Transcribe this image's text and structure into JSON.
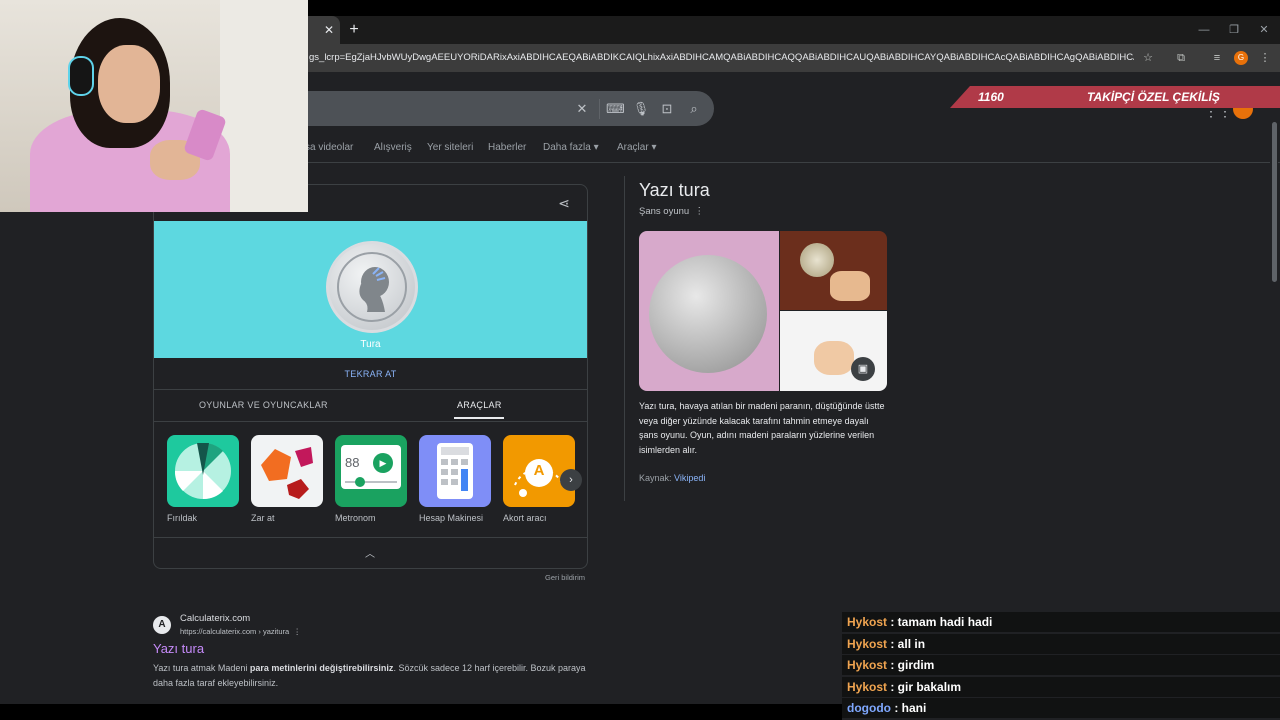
{
  "browser": {
    "url": "gs_lcrp=EgZjaHJvbWUyDwgAEEUYORiDARixAxiABDIHCAEQABiABDIKCAIQLhixAxiABDIHCAMQABiABDIHCAQQABiABDIHCAUQABiABDIHCAYQABiABDIHCAcQABiABDIHCAgQABiABDIHCAkQABiABNIB...",
    "profile_initial": "G"
  },
  "nav": {
    "items": [
      "sa videolar",
      "Alışveriş",
      "Yer siteleri",
      "Haberler",
      "Daha fazla",
      "Araçlar"
    ]
  },
  "coin_card": {
    "result_label": "Tura",
    "retry_label": "TEKRAR AT",
    "tabs": [
      "OYUNLAR VE OYUNCAKLAR",
      "ARAÇLAR"
    ],
    "active_tab": "ARAÇLAR",
    "tools": [
      {
        "name": "Fırıldak",
        "color": "#1ec99e"
      },
      {
        "name": "Zar at",
        "color": "#f1f3f4"
      },
      {
        "name": "Metronom",
        "color": "#1aa260",
        "display": "88"
      },
      {
        "name": "Hesap Makinesi",
        "color": "#7f8ef7"
      },
      {
        "name": "Akort aracı",
        "color": "#f29900",
        "display": "A"
      }
    ],
    "feedback": "Geri bildirim"
  },
  "result": {
    "logo_letter": "A",
    "site": "Calculaterix.com",
    "url": "https://calculaterix.com › yazitura",
    "title": "Yazı tura",
    "snippet_a": "Yazı tura atmak Madeni ",
    "snippet_bold": "para metinlerini değiştirebilirsiniz",
    "snippet_b": ". Sözcük sadece 12 harf içerebilir. Bozuk paraya daha fazla taraf ekleyebilirsiniz."
  },
  "knowledge_panel": {
    "title": "Yazı tura",
    "subtitle": "Şans oyunu",
    "description": "Yazı tura, havaya atılan bir madeni paranın, düştüğünde üstte veya diğer yüzünde kalacak tarafını tahmin etmeye dayalı şans oyunu. Oyun, adını madeni paraların yüzlerine verilen isimlerden alır.",
    "source_label": "Kaynak: ",
    "source_link": "Vikipedi"
  },
  "stream": {
    "banner_number": "1160",
    "banner_text": "TAKİPÇİ ÖZEL ÇEKİLİŞ",
    "chat": [
      {
        "user": "Hykost",
        "msg": " : tamam hadi hadi"
      },
      {
        "user": "Hykost",
        "msg": " : all in"
      },
      {
        "user": "Hykost",
        "msg": " : girdim"
      },
      {
        "user": "Hykost",
        "msg": " : gir bakalım"
      },
      {
        "user": "dogodo",
        "msg": " : hani",
        "color": "#7fa8ff"
      }
    ]
  },
  "colors": {
    "page_bg": "#202124",
    "link": "#8ab4f8",
    "visited": "#c58af9",
    "coin_bg": "#5dd8e0",
    "banner": "#b03a48",
    "chat_user": "#f0a450"
  }
}
